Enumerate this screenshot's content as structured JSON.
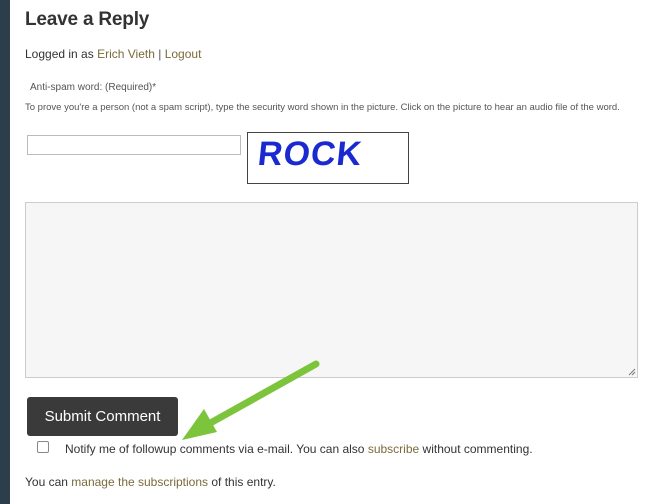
{
  "reply": {
    "title": "Leave a Reply",
    "logged_in_prefix": "Logged in as",
    "user_name": "Erich Vieth",
    "separator": "|",
    "logout_label": "Logout"
  },
  "antispam": {
    "label": "Anti-spam word: (Required)",
    "required_mark": "*",
    "instructions": "To prove you're a person (not a spam script), type the security word shown in the picture. Click on the picture to hear an audio file of the word.",
    "input_value": "",
    "captcha_word": "ROCK"
  },
  "comment": {
    "value": ""
  },
  "submit": {
    "label": "Submit Comment"
  },
  "notify": {
    "checked": false,
    "text_before": "Notify me of followup comments via e-mail. You can also",
    "subscribe_link": "subscribe",
    "text_after": "without commenting."
  },
  "footer": {
    "prefix": "You can",
    "link": "manage the subscriptions",
    "suffix": "of this entry."
  },
  "colors": {
    "link": "#7a6a3a",
    "button_bg": "#3a3a3a",
    "captcha_text": "#1a2ad0",
    "arrow": "#7bc43c"
  },
  "annotations": {
    "arrow_icon": "green-arrow-pointing-to-checkbox"
  }
}
